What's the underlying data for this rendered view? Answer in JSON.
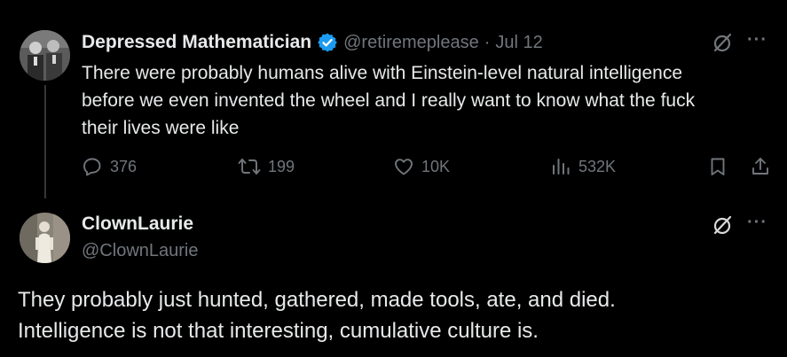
{
  "tweet": {
    "author_name": "Depressed Mathematician",
    "handle": "@retiremeplease",
    "separator": "·",
    "date": "Jul 12",
    "text_lines": [
      "There were probably humans alive with Einstein-level natural intelligence",
      "before we even invented the wheel and I really want to know what the fuck",
      "their lives were like"
    ],
    "stats": {
      "replies": "376",
      "retweets": "199",
      "likes": "10K",
      "views": "532K"
    },
    "verified_color": "#1d9bf0",
    "more_glyph": "···"
  },
  "reply": {
    "author_name": "ClownLaurie",
    "handle": "@ClownLaurie",
    "text_lines": [
      "They probably just hunted, gathered, made tools, ate, and died.",
      "Intelligence is not that interesting, cumulative culture is."
    ],
    "more_glyph": "···"
  }
}
